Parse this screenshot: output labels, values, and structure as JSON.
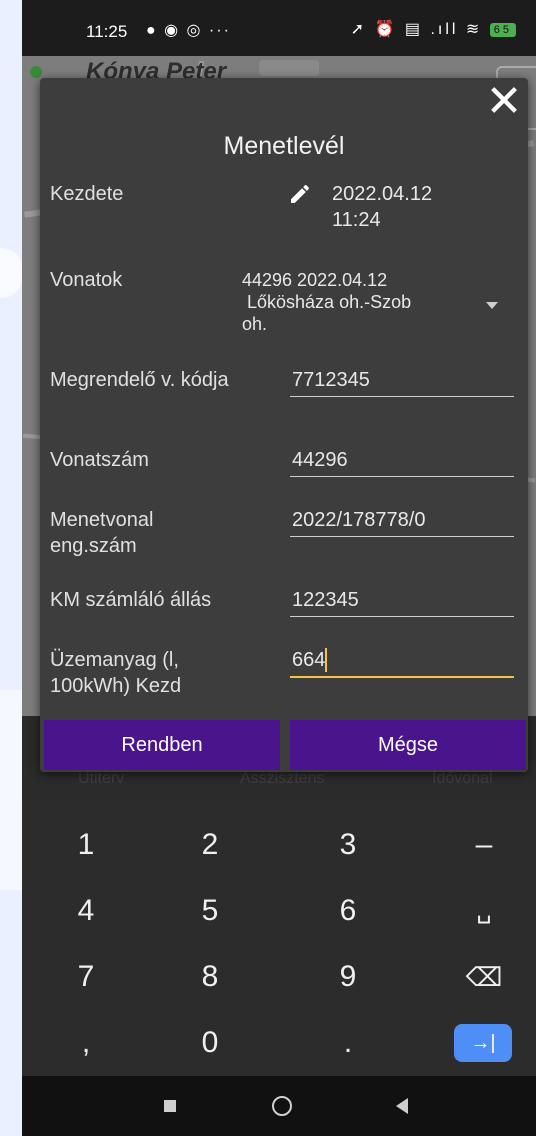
{
  "status_bar": {
    "time": "11:25",
    "left_icons": "● ◉ ◎ ···",
    "right_icons": "➚ ⏰ ▤ .ıll ≋",
    "battery": "65"
  },
  "map": {
    "title": "Kónya Peter"
  },
  "bottom_tabs": [
    "Útiterv",
    "Asszisztens",
    "Idővonal"
  ],
  "dialog": {
    "close_symbol": "✕",
    "title": "Menetlevél",
    "start_label": "Kezdete",
    "start_date": "2022.04.12",
    "start_time": "11:24",
    "trains_label": "Vonatok",
    "trains_line1": "44296 2022.04.12",
    "trains_line2": " Lőkösháza oh.-Szob",
    "trains_line3": "oh.",
    "customer_label": "Megrendelő v. kódja",
    "customer_value": "7712345",
    "train_no_label": "Vonatszám",
    "train_no_value": "44296",
    "route_label_1": "Menetvonal",
    "route_label_2": "eng.szám",
    "route_value": "2022/178778/0",
    "km_label": "KM számláló állás",
    "km_value": "122345",
    "fuel_label_1": "Üzemanyag (l,",
    "fuel_label_2": "100kWh) Kezd",
    "fuel_value": "664",
    "ok_label": "Rendben",
    "cancel_label": "Mégse"
  },
  "keyboard": {
    "rows": [
      [
        "1",
        "2",
        "3",
        "–"
      ],
      [
        "4",
        "5",
        "6",
        "␣"
      ],
      [
        "7",
        "8",
        "9",
        "⌫"
      ],
      [
        ",",
        "0",
        ".",
        "→|"
      ]
    ]
  }
}
